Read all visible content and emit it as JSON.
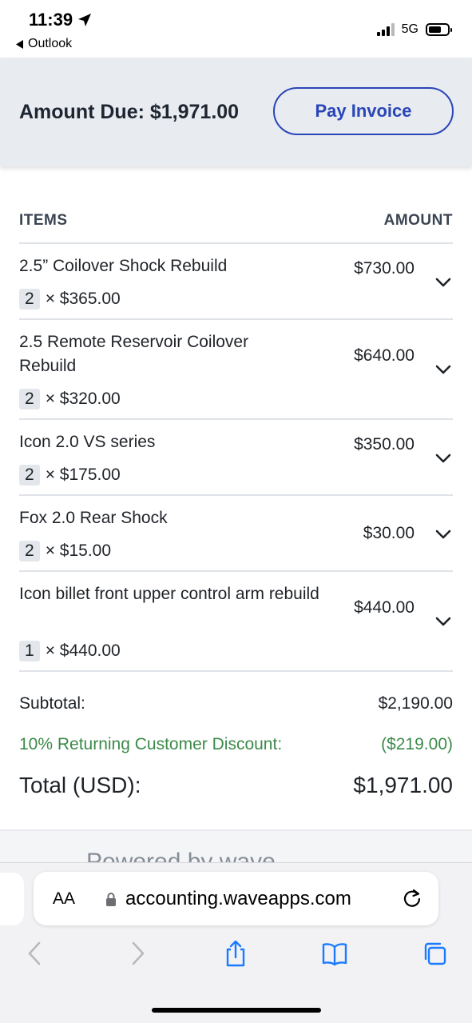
{
  "status_bar": {
    "time": "11:39",
    "back_app": "Outlook",
    "network": "5G"
  },
  "header": {
    "amount_due": "Amount Due: $1,971.00",
    "pay_button": "Pay Invoice"
  },
  "items_table": {
    "col_items": "ITEMS",
    "col_amount": "AMOUNT",
    "rows": [
      {
        "name": "2.5” Coilover Shock Rebuild",
        "qty": "2",
        "unit": "× $365.00",
        "amount": "$730.00"
      },
      {
        "name": "2.5 Remote Reservoir Coilover Rebuild",
        "qty": "2",
        "unit": "× $320.00",
        "amount": "$640.00"
      },
      {
        "name": "Icon 2.0 VS series",
        "qty": "2",
        "unit": "× $175.00",
        "amount": "$350.00"
      },
      {
        "name": "Fox 2.0 Rear Shock",
        "qty": "2",
        "unit": "× $15.00",
        "amount": "$30.00"
      },
      {
        "name": "Icon billet front upper control arm rebuild",
        "qty": "1",
        "unit": "× $440.00",
        "amount": "$440.00"
      }
    ]
  },
  "totals": {
    "subtotal_label": "Subtotal:",
    "subtotal_value": "$2,190.00",
    "discount_label": "10% Returning Customer Discount:",
    "discount_value": "($219.00)",
    "total_label": "Total (USD):",
    "total_value": "$1,971.00"
  },
  "footer": {
    "powered_by": "Powered by wave"
  },
  "browser": {
    "text_size_label": "AA",
    "url": "accounting.waveapps.com"
  },
  "colors": {
    "accent": "#2945b8",
    "discount": "#3c8a4a",
    "header_bg": "#e8ebef",
    "toolbar_icons": "#1a7bff"
  },
  "icons": [
    "location-arrow-icon",
    "back-triangle-icon",
    "signal-icon",
    "battery-icon",
    "chevron-down-icon",
    "lock-icon",
    "reload-icon",
    "back-icon",
    "forward-icon",
    "share-icon",
    "bookmarks-icon",
    "tabs-icon"
  ]
}
